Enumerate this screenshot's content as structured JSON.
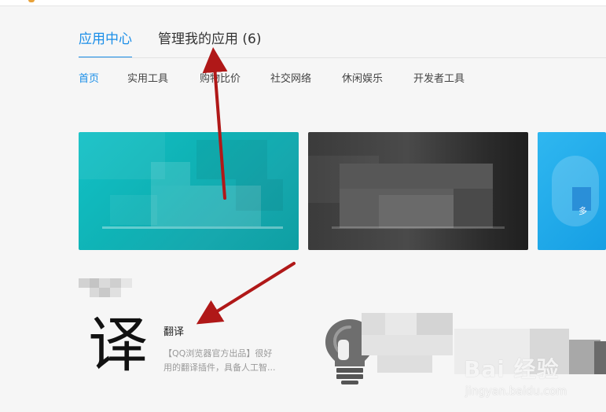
{
  "tabs": {
    "app_center": "应用中心",
    "manage_apps": "管理我的应用 (6)"
  },
  "categories": [
    "首页",
    "实用工具",
    "购物比价",
    "社交网络",
    "休闲娱乐",
    "开发者工具"
  ],
  "featured_app": {
    "icon_char": "译",
    "name": "翻译",
    "desc_line1": "【QQ浏览器官方出品】很好",
    "desc_line2": "用的翻译插件，具备人工智..."
  },
  "watermark": {
    "brand": "Bai 经验",
    "url": "jingyan.baidu.com"
  },
  "banner3_text": "多",
  "colors": {
    "accent": "#1a8ee8",
    "annotation_arrow": "#b01818"
  }
}
